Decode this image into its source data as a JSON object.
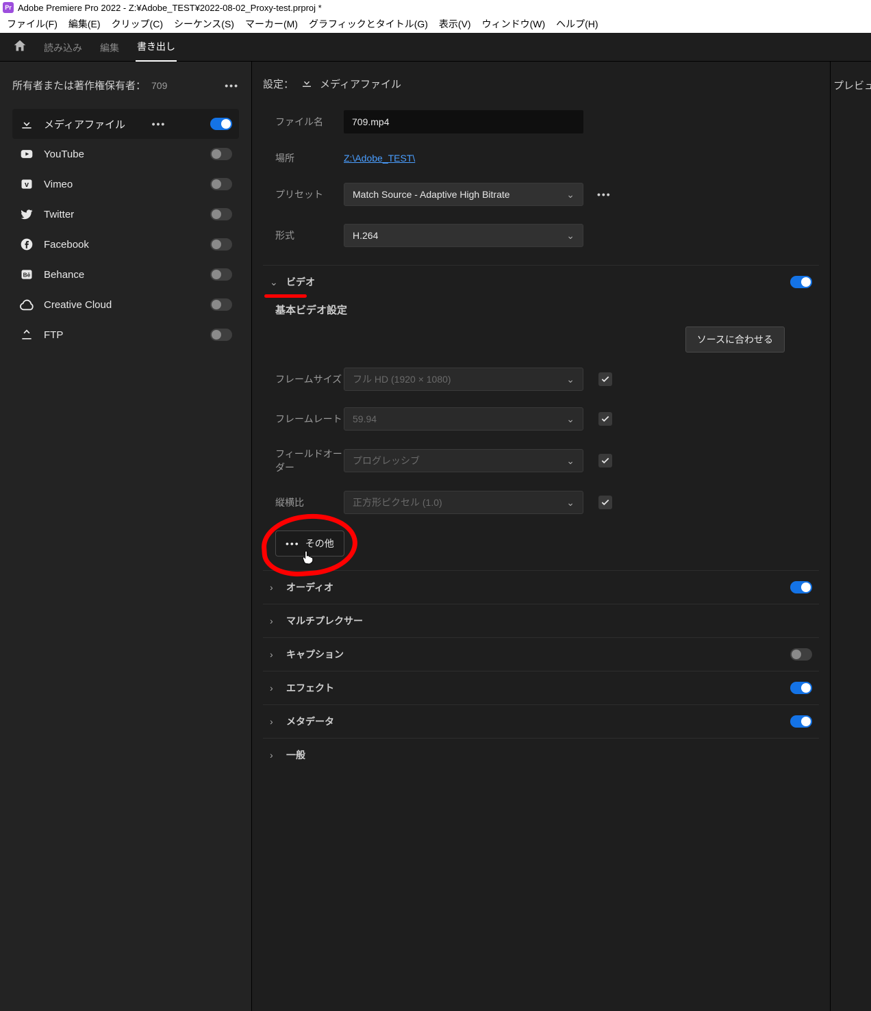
{
  "titlebar": {
    "app_short": "Pr",
    "title": "Adobe Premiere Pro 2022 - Z:¥Adobe_TEST¥2022-08-02_Proxy-test.prproj *"
  },
  "menubar": {
    "file": "ファイル(F)",
    "edit": "編集(E)",
    "clip": "クリップ(C)",
    "sequence": "シーケンス(S)",
    "marker": "マーカー(M)",
    "graphics": "グラフィックとタイトル(G)",
    "view": "表示(V)",
    "window": "ウィンドウ(W)",
    "help": "ヘルプ(H)"
  },
  "toptabs": {
    "import": "読み込み",
    "edit": "編集",
    "export": "書き出し"
  },
  "left": {
    "owner_label": "所有者または著作権保有者：",
    "owner_value": "709",
    "destinations": [
      {
        "label": "メディアファイル",
        "on": true,
        "active": true,
        "icon": "download"
      },
      {
        "label": "YouTube",
        "on": false,
        "icon": "youtube"
      },
      {
        "label": "Vimeo",
        "on": false,
        "icon": "vimeo"
      },
      {
        "label": "Twitter",
        "on": false,
        "icon": "twitter"
      },
      {
        "label": "Facebook",
        "on": false,
        "icon": "facebook"
      },
      {
        "label": "Behance",
        "on": false,
        "icon": "behance"
      },
      {
        "label": "Creative Cloud",
        "on": false,
        "icon": "cc"
      },
      {
        "label": "FTP",
        "on": false,
        "icon": "upload"
      }
    ]
  },
  "settings": {
    "header_label": "設定：",
    "header_dest": "メディアファイル",
    "file_name_label": "ファイル名",
    "file_name_value": "709.mp4",
    "location_label": "場所",
    "location_value": "Z:\\Adobe_TEST\\",
    "preset_label": "プリセット",
    "preset_value": "Match Source - Adaptive High Bitrate",
    "format_label": "形式",
    "format_value": "H.264"
  },
  "video": {
    "section_label": "ビデオ",
    "basic_label": "基本ビデオ設定",
    "match_source_btn": "ソースに合わせる",
    "frame_size_label": "フレームサイズ",
    "frame_size_value": "フル HD (1920 × 1080)",
    "frame_rate_label": "フレームレート",
    "frame_rate_value": "59.94",
    "field_order_label": "フィールドオーダー",
    "field_order_value": "プログレッシブ",
    "aspect_label": "縦横比",
    "aspect_value": "正方形ピクセル (1.0)",
    "more_btn": "その他"
  },
  "sections": {
    "audio": "オーディオ",
    "mux": "マルチプレクサー",
    "caption": "キャプション",
    "effect": "エフェクト",
    "metadata": "メタデータ",
    "general": "一般"
  },
  "section_state": {
    "audio": true,
    "caption": false,
    "effect": true,
    "metadata": true
  },
  "preview": {
    "label": "プレビュ"
  }
}
